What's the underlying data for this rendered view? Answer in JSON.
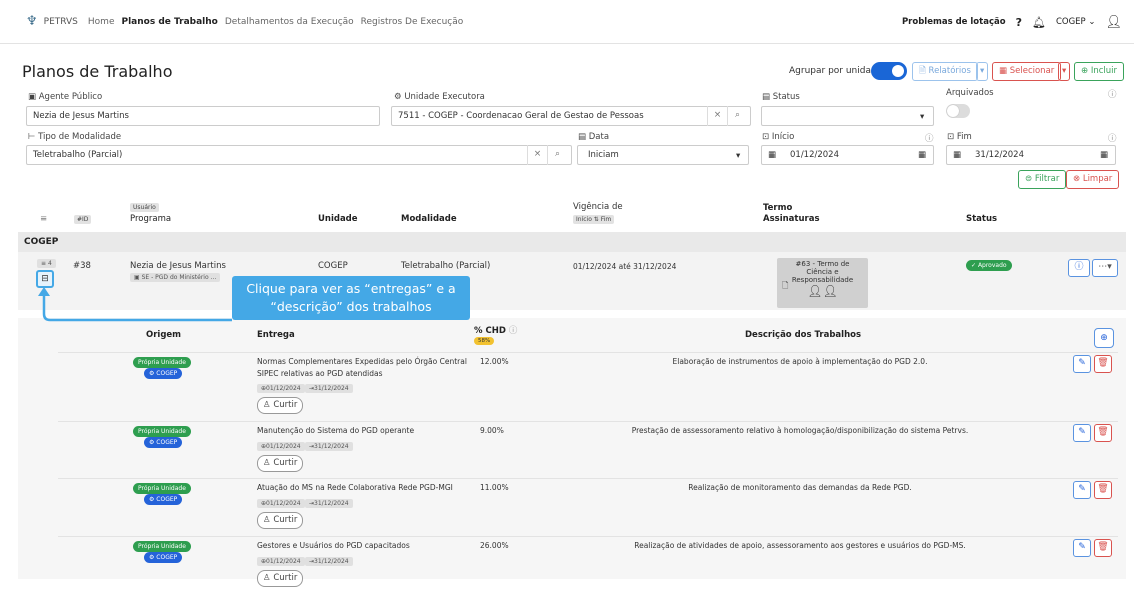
{
  "brand": "PETRVS",
  "nav": [
    "Home",
    "Planos de Trabalho",
    "Detalhamentos da Execução",
    "Registros De Execução"
  ],
  "topright": {
    "lotacao": "Problemas de lotação",
    "help": "?",
    "unit": "COGEP"
  },
  "page_title": "Planos de Trabalho",
  "agrupar": "Agrupar por unidade",
  "buttons": {
    "relatorios": "Relatórios",
    "selecionar": "Selecionar",
    "incluir": "Incluir",
    "filtrar": "Filtrar",
    "limpar": "Limpar"
  },
  "filters": {
    "agente_label": "Agente Público",
    "agente_value": "Nezia de Jesus Martins",
    "unidade_label": "Unidade Executora",
    "unidade_value": "7511 - COGEP - Coordenacao Geral de Gestao de Pessoas",
    "status_label": "Status",
    "arquivados_label": "Arquivados",
    "modalidade_label": "Tipo de Modalidade",
    "modalidade_value": "Teletrabalho (Parcial)",
    "data_label": "Data",
    "data_value": "Iniciam",
    "inicio_label": "Início",
    "inicio_value": "01/12/2024",
    "fim_label": "Fim",
    "fim_value": "31/12/2024"
  },
  "table_headers": {
    "id": "#ID",
    "usuario": "Usuário",
    "programa": "Programa",
    "unidade": "Unidade",
    "modalidade": "Modalidade",
    "vigencia": "Vigência de",
    "inicio": "Início",
    "fim": "Fim",
    "termo": "Termo",
    "assinaturas": "Assinaturas",
    "status": "Status"
  },
  "group": "COGEP",
  "row": {
    "count": "4",
    "id": "#38",
    "nome": "Nezia de Jesus Martins",
    "programa": "SE - PGD do Ministério ...",
    "unidade": "COGEP",
    "modalidade": "Teletrabalho (Parcial)",
    "vigencia": "01/12/2024 até 31/12/2024",
    "termo": "#63 - Termo de Ciência e Responsabilidade",
    "status": "Aprovado"
  },
  "callout": "Clique para ver as “entregas” e a “descrição” dos trabalhos",
  "sub_headers": {
    "origem": "Origem",
    "entrega": "Entrega",
    "chd": "% CHD",
    "chd_badge": "58%",
    "descricao": "Descrição dos Trabalhos"
  },
  "entregas": [
    {
      "origem": "Própria Unidade",
      "unidade": "COGEP",
      "entrega1": "Normas Complementares Expedidas pelo Órgão Central",
      "entrega2": "SIPEC relativas ao PGD atendidas",
      "inicio": "01/12/2024",
      "fim": "31/12/2024",
      "curtir": "Curtir",
      "chd": "12.00%",
      "descricao": "Elaboração de instrumentos de apoio à implementação do PGD 2.0."
    },
    {
      "origem": "Própria Unidade",
      "unidade": "COGEP",
      "entrega1": "Manutenção do Sistema do PGD operante",
      "entrega2": "",
      "inicio": "01/12/2024",
      "fim": "31/12/2024",
      "curtir": "Curtir",
      "chd": "9.00%",
      "descricao": "Prestação de assessoramento relativo à homologação/disponibilização do sistema Petrvs."
    },
    {
      "origem": "Própria Unidade",
      "unidade": "COGEP",
      "entrega1": "Atuação do MS na Rede Colaborativa Rede PGD-MGI",
      "entrega2": "",
      "inicio": "01/12/2024",
      "fim": "31/12/2024",
      "curtir": "Curtir",
      "chd": "11.00%",
      "descricao": "Realização de monitoramento das demandas da Rede PGD."
    },
    {
      "origem": "Própria Unidade",
      "unidade": "COGEP",
      "entrega1": "Gestores e Usuários do PGD capacitados",
      "entrega2": "",
      "inicio": "01/12/2024",
      "fim": "31/12/2024",
      "curtir": "Curtir",
      "chd": "26.00%",
      "descricao": "Realização de atividades de apoio, assessoramento aos gestores e usuários do PGD-MS."
    }
  ]
}
